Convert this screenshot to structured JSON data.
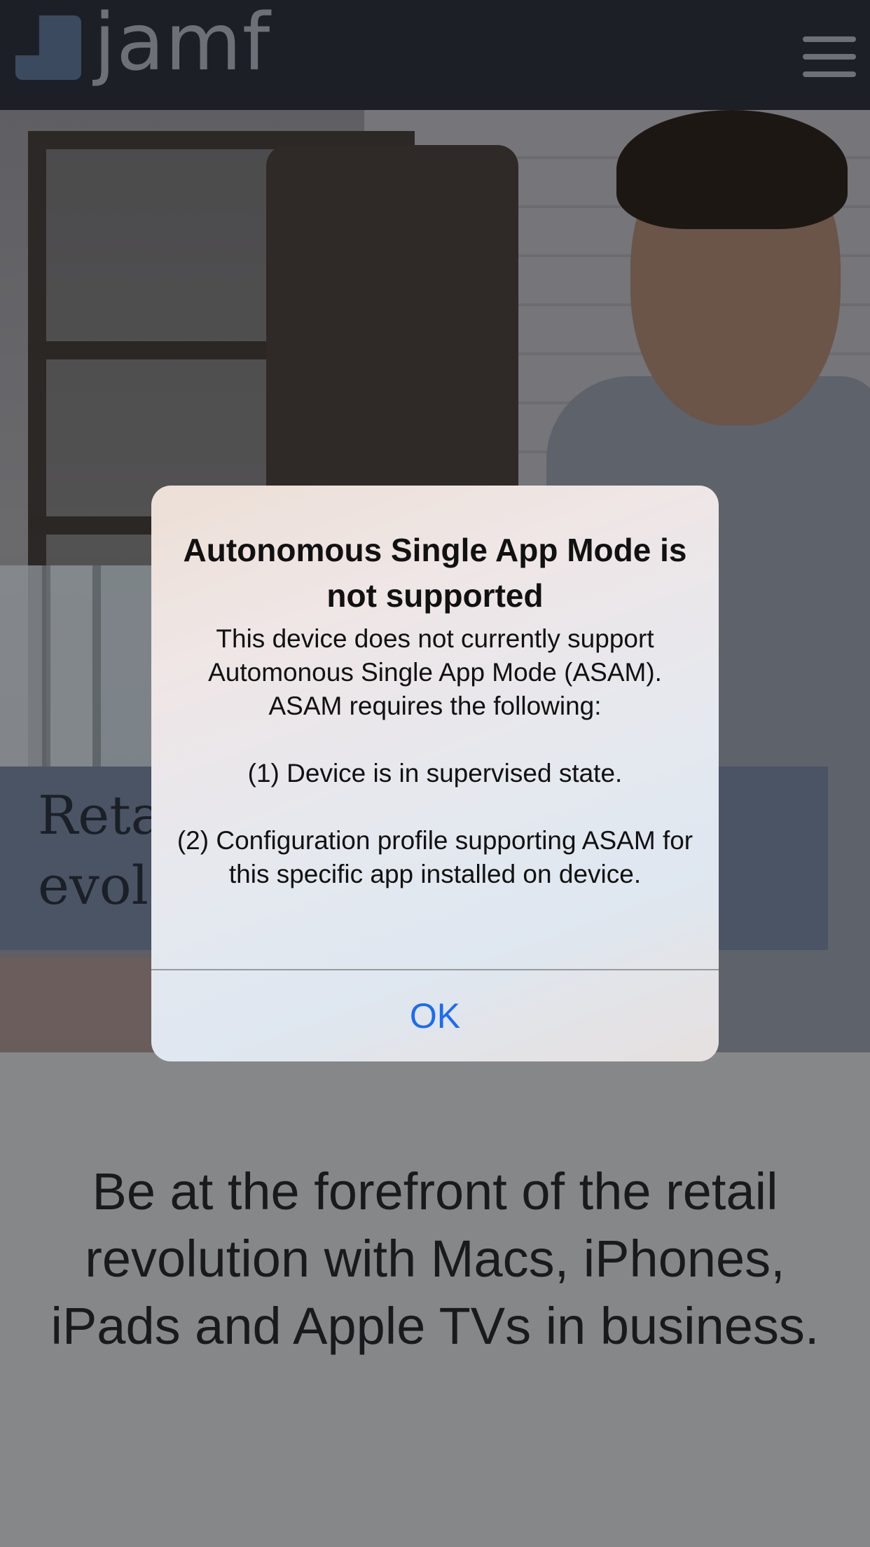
{
  "header": {
    "logo_text": "jamf",
    "menu_icon": "hamburger-menu-icon",
    "background": "#1c1f26"
  },
  "hero": {
    "banner_text_partial": "Reta\nevol"
  },
  "main": {
    "tagline": "Be at the forefront of the retail revolution with Macs, iPhones, iPads and Apple TVs in business."
  },
  "alert": {
    "title": "Autonomous Single App Mode is not supported",
    "message": [
      "This device does not currently support Automonous Single App Mode (ASAM). ASAM requires the following:",
      "(1) Device is in supervised state.",
      "(2) Configuration profile supporting ASAM for this specific app installed on device."
    ],
    "ok_label": "OK",
    "ok_color": "#1a6cf5"
  }
}
